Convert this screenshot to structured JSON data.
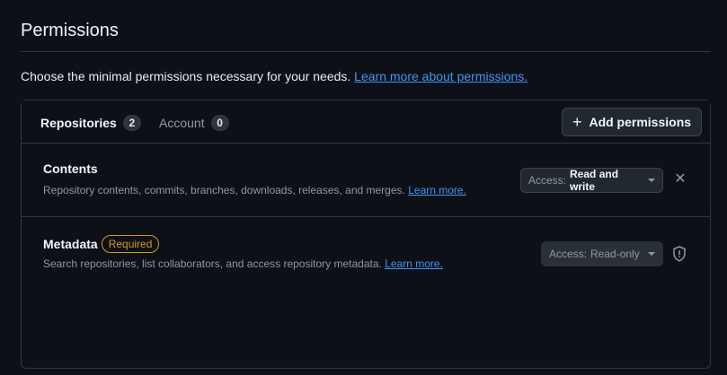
{
  "header": {
    "title": "Permissions",
    "intro_text": "Choose the minimal permissions necessary for your needs.",
    "intro_link": "Learn more about permissions."
  },
  "tabs": [
    {
      "label": "Repositories",
      "count": "2",
      "active": true
    },
    {
      "label": "Account",
      "count": "0",
      "active": false
    }
  ],
  "add_button": {
    "label": "Add permissions",
    "icon": "plus-icon"
  },
  "permissions": [
    {
      "title": "Contents",
      "description": "Repository contents, commits, branches, downloads, releases, and merges.",
      "link": "Learn more.",
      "access_prefix": "Access:",
      "access_value": "Read and write",
      "action_icon": "close-icon"
    },
    {
      "title": "Metadata",
      "badge": "Required",
      "description": "Search repositories, list collaborators, and access repository metadata.",
      "link": "Learn more.",
      "access_prefix": "Access:",
      "access_value": "Read-only",
      "action_icon": "shield-icon"
    }
  ],
  "colors": {
    "background": "#0d1117",
    "border": "#30363d",
    "link": "#4493f8",
    "required": "#d29922"
  }
}
